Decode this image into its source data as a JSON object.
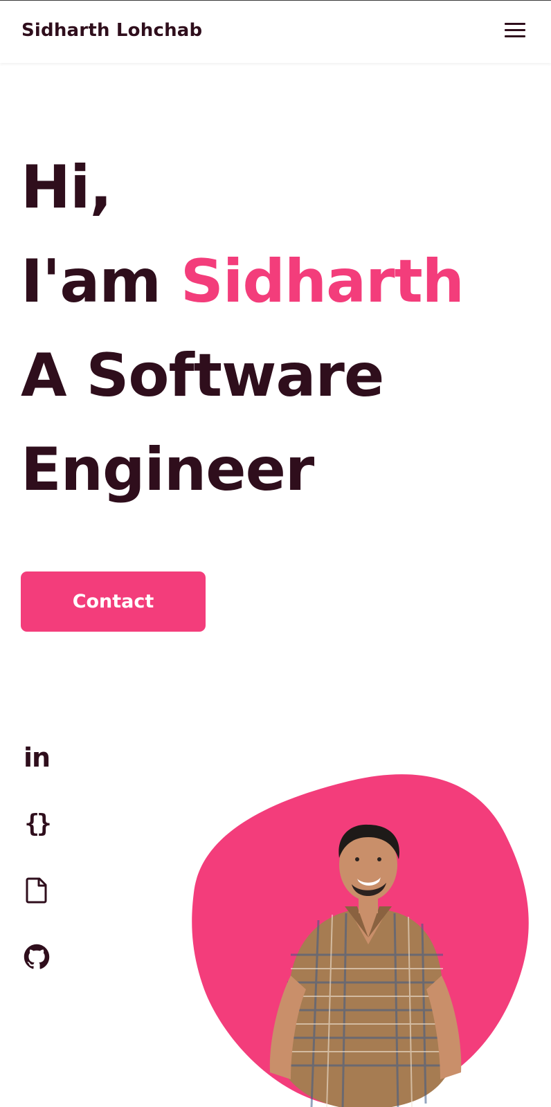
{
  "header": {
    "logo": "Sidharth Lohchab",
    "menu_icon": "hamburger-menu-icon"
  },
  "hero": {
    "greeting": "Hi,",
    "intro_prefix": "I'am ",
    "name": "Sidharth",
    "role_line1": "A Software",
    "role_line2": "Engineer"
  },
  "contact_button": {
    "label": "Contact"
  },
  "social": [
    {
      "icon": "linkedin-icon",
      "glyph": "in"
    },
    {
      "icon": "code-braces-icon",
      "glyph": "{}"
    },
    {
      "icon": "document-icon"
    },
    {
      "icon": "github-icon"
    }
  ],
  "colors": {
    "accent": "#f33d7b",
    "text": "#2f0e1c",
    "background": "#ffffff"
  }
}
